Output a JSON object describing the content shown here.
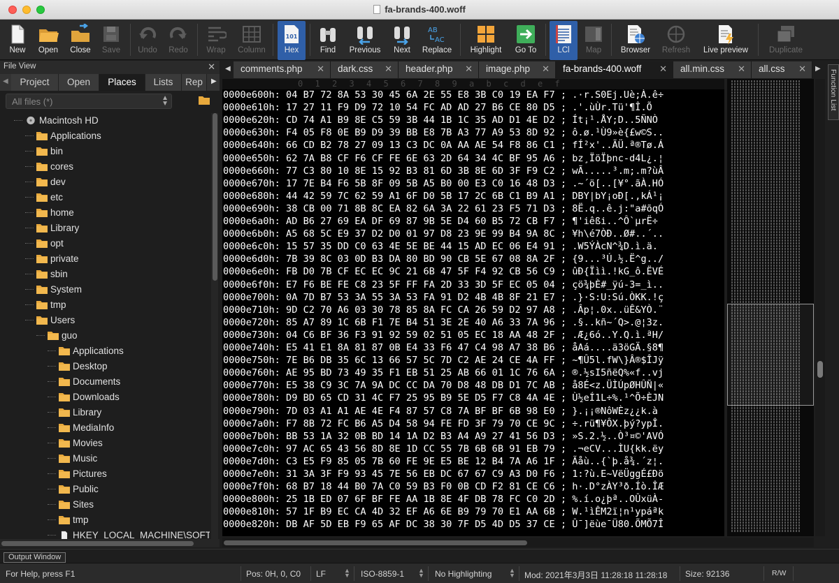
{
  "window": {
    "title": "fa-brands-400.woff"
  },
  "toolbar": {
    "new": "New",
    "open": "Open",
    "close": "Close",
    "save": "Save",
    "undo": "Undo",
    "redo": "Redo",
    "wrap": "Wrap",
    "column": "Column",
    "hex": "Hex",
    "find": "Find",
    "previous": "Previous",
    "next": "Next",
    "replace": "Replace",
    "highlight": "Highlight",
    "goto": "Go To",
    "lcl": "LCl",
    "map": "Map",
    "browser": "Browser",
    "refresh": "Refresh",
    "live_preview": "Live preview",
    "duplicate": "Duplicate"
  },
  "file_view": {
    "title": "File View",
    "tabs": [
      "Project",
      "Open",
      "Places",
      "Lists",
      "Rep"
    ],
    "active_tab": "Places",
    "filter": "All files (*)",
    "tree": [
      {
        "name": "Macintosh HD",
        "depth": 0,
        "type": "disk"
      },
      {
        "name": "Applications",
        "depth": 1,
        "type": "folder"
      },
      {
        "name": "bin",
        "depth": 1,
        "type": "folder"
      },
      {
        "name": "cores",
        "depth": 1,
        "type": "folder"
      },
      {
        "name": "dev",
        "depth": 1,
        "type": "folder"
      },
      {
        "name": "etc",
        "depth": 1,
        "type": "folder"
      },
      {
        "name": "home",
        "depth": 1,
        "type": "folder"
      },
      {
        "name": "Library",
        "depth": 1,
        "type": "folder"
      },
      {
        "name": "opt",
        "depth": 1,
        "type": "folder"
      },
      {
        "name": "private",
        "depth": 1,
        "type": "folder"
      },
      {
        "name": "sbin",
        "depth": 1,
        "type": "folder"
      },
      {
        "name": "System",
        "depth": 1,
        "type": "folder"
      },
      {
        "name": "tmp",
        "depth": 1,
        "type": "folder"
      },
      {
        "name": "Users",
        "depth": 1,
        "type": "folder"
      },
      {
        "name": "guo",
        "depth": 2,
        "type": "folder"
      },
      {
        "name": "Applications",
        "depth": 3,
        "type": "folder"
      },
      {
        "name": "Desktop",
        "depth": 3,
        "type": "folder"
      },
      {
        "name": "Documents",
        "depth": 3,
        "type": "folder"
      },
      {
        "name": "Downloads",
        "depth": 3,
        "type": "folder"
      },
      {
        "name": "Library",
        "depth": 3,
        "type": "folder"
      },
      {
        "name": "MediaInfo",
        "depth": 3,
        "type": "folder"
      },
      {
        "name": "Movies",
        "depth": 3,
        "type": "folder"
      },
      {
        "name": "Music",
        "depth": 3,
        "type": "folder"
      },
      {
        "name": "Pictures",
        "depth": 3,
        "type": "folder"
      },
      {
        "name": "Public",
        "depth": 3,
        "type": "folder"
      },
      {
        "name": "Sites",
        "depth": 3,
        "type": "folder"
      },
      {
        "name": "tmp",
        "depth": 3,
        "type": "folder"
      },
      {
        "name": "HKEY_LOCAL_MACHINE\\SOFTWA",
        "depth": 3,
        "type": "file"
      }
    ]
  },
  "doc_tabs": [
    {
      "label": "comments.php"
    },
    {
      "label": "dark.css"
    },
    {
      "label": "header.php"
    },
    {
      "label": "image.php"
    },
    {
      "label": "fa-brands-400.woff",
      "active": true
    },
    {
      "label": "all.min.css"
    },
    {
      "label": "all.css"
    }
  ],
  "function_list": "Function List",
  "hex": {
    "ruler": [
      "0",
      "1",
      "2",
      "3",
      "4",
      "5",
      "6",
      "7",
      "8",
      "9",
      "a",
      "b",
      "c",
      "d",
      "e",
      "f"
    ],
    "rows": [
      "0000e600h: 04 B7 72 8A 53 30 45 6A 2E 55 E8 3B C0 19 EA F7 ; .·r.S0Ej.Uè;À.ê÷",
      "0000e610h: 17 27 11 F9 D9 72 10 54 FC AD AD 27 B6 CE 80 D5 ; .'.ùÙr.Tü­­'¶Î.Õ",
      "0000e620h: CD 74 A1 B9 8E C5 59 3B 44 1B 1C 35 AD D1 4E D2 ; Ít¡¹.ÅY;D..5­ÑNÒ",
      "0000e630h: F4 05 F8 0E B9 D9 39 BB E8 7B A3 77 A9 53 8D 92 ; ô.ø.¹Ù9»è{£w©S..",
      "0000e640h: 66 CD B2 78 27 09 13 C3 DC 0A AA AE 54 F8 86 C1 ; fÍ²x'..ÃÜ.ª®Tø.Á",
      "0000e650h: 62 7A B8 CF F6 CF FE 6E 63 2D 64 34 4C BF 95 A6 ; bz¸ÏöÏþnc-d4L¿.¦",
      "0000e660h: 77 C3 80 10 8E 15 92 B3 81 6D 3B 8E 6D 3F F9 C2 ; wÃ.....³.m;.m?ùÂ",
      "0000e670h: 17 7E B4 F6 5B 8F 09 5B A5 B0 00 E3 C0 16 48 D3 ; .~´ö[..[¥°.ãÀ.HÓ",
      "0000e680h: 44 42 59 7C 62 59 A1 6F D0 5B 17 2C 6B C1 B9 A1 ; DBY|bY¡oÐ[.,kÁ¹¡",
      "0000e690h: 38 CB 00 71 8B 8C EA 82 6A 3A 22 61 23 F5 71 D3 ; 8Ë.q..ê.j:\"a#õqÓ",
      "0000e6a0h: AD B6 27 69 EA DF 69 87 9B 5E D4 60 B5 72 CB F7 ; ­¶'iêßi..^Ô`µrË÷",
      "0000e6b0h: A5 68 5C E9 37 D2 D0 01 97 D8 23 9E 99 B4 9A 8C ; ¥h\\é7ÒÐ..Ø#..´..",
      "0000e6c0h: 15 57 35 DD C0 63 4E 5E BE 44 15 AD EC 06 E4 91 ; .W5ÝÀcN^¾D.­ì.ä.",
      "0000e6d0h: 7B 39 8C 03 0D B3 DA 80 BD 90 CB 5E 67 08 8A 2F ; {9...³Ú.½.Ë^g../",
      "0000e6e0h: FB D0 7B CF EC EC 9C 21 6B 47 5F F4 92 CB 56 C9 ; ûÐ{Ïìì.!kG_ô.ËVÉ",
      "0000e6f0h: E7 F6 BE FE C8 23 5F FF FA 2D 33 3D 5F EC 05 04 ; çö¾þÈ#_ÿú-3=_ì..",
      "0000e700h: 0A 7D B7 53 3A 55 3A 53 FA 91 D2 4B 4B 8F 21 E7 ; .}·S:U:Sú.ÒKK.!ç",
      "0000e710h: 9D C2 70 A6 03 30 78 85 8A FC CA 26 59 D2 97 A8 ; .Âp¦.0x..üÊ&YÒ.¨",
      "0000e720h: 85 A7 89 1C 6B F1 7E B4 51 3E 2E 40 A6 33 7A 96 ; .§..kñ~´Q>.@¦3z.",
      "0000e730h: 04 C6 BF 36 F3 91 92 59 02 51 05 EC 18 AA 48 2F ; .Æ¿6ó..Y.Q.ì.ªH/",
      "0000e740h: E5 41 E1 8A 81 87 0B E4 33 F6 47 C4 98 A7 38 B6 ; åAá....ä3öGÄ.§8¶",
      "0000e750h: 7E B6 DB 35 6C 13 66 57 5C 7D C2 AE 24 CE 4A FF ; ~¶Û5l.fW\\}Â®$ÎJÿ",
      "0000e760h: AE 95 BD 73 49 35 F1 EB 51 25 AB 66 01 1C 76 6A ; ®.½sI5ñëQ%«f..vj",
      "0000e770h: E5 38 C9 3C 7A 9A DC CC DA 70 D8 48 DB D1 7C AB ; å8É<z.ÜÌÚpØHÛÑ|«",
      "0000e780h: D9 BD 65 CD 31 4C F7 25 95 B9 5E D5 F7 C8 4A 4E ; Ù½eÍ1L÷%.¹^Õ÷ÈJN",
      "0000e790h: 7D 03 A1 A1 AE 4E F4 87 57 C8 7A BF BF 6B 98 E0 ; }.¡¡®NôWÈz¿¿k.à",
      "0000e7a0h: F7 8B 72 FC B6 A5 D4 58 94 FE FD 3F 79 70 CE 9C ; ÷.rü¶¥ÔX.þý?ypÎ.",
      "0000e7b0h: BB 53 1A 32 0B BD 14 1A D2 B3 A4 A9 27 41 56 D3 ; »S.2.½..Ò³¤©'AVÓ",
      "0000e7c0h: 97 AC 65 43 56 8D 8E 1D CC 55 7B 6B 6B 91 EB 79 ; .¬eCV...ÌU{kk.ëy",
      "0000e7d0h: C3 E5 F9 85 05 7B 60 FE 9E E5 BE 12 B4 7A A6 1F ; Ãåù..{`þ.å¾.´z¦.",
      "0000e7e0h: 31 3A 3F F9 93 45 7E 56 EB DC 67 67 C9 A3 D0 F6 ; 1:?ù.E~VëÜggÉ£Ðö",
      "0000e7f0h: 68 B7 18 44 B0 7A C0 59 B3 F0 0B CD F2 81 CE C6 ; h·.D°zÀY³ð.Íò.ÎÆ",
      "0000e800h: 25 1B ED 07 6F BF FE AA 1B 8E 4F DB 78 FC C0 2D ; %.í.o¿þª..OÛxüÀ-",
      "0000e810h: 57 1F B9 EC CA 4D 32 EF A6 6E B9 79 70 E1 AA 6B ; W.¹ìÊM2ï¦n¹ypáªk",
      "0000e820h: DB AF 5D EB F9 65 AF DC 38 30 7F D5 4D D5 37 CE ; Û¯]ëùe¯Ü80.ÕMÕ7Î"
    ]
  },
  "output_window": "Output Window",
  "status": {
    "help": "For Help, press F1",
    "pos": "Pos: 0H, 0, C0",
    "line_ending": "LF",
    "encoding": "ISO-8859-1",
    "highlighting": "No Highlighting",
    "modified": "Mod: 2021年3月3日 11:28:18 11:28:18",
    "size": "Size: 92136",
    "rw": "R/W"
  }
}
